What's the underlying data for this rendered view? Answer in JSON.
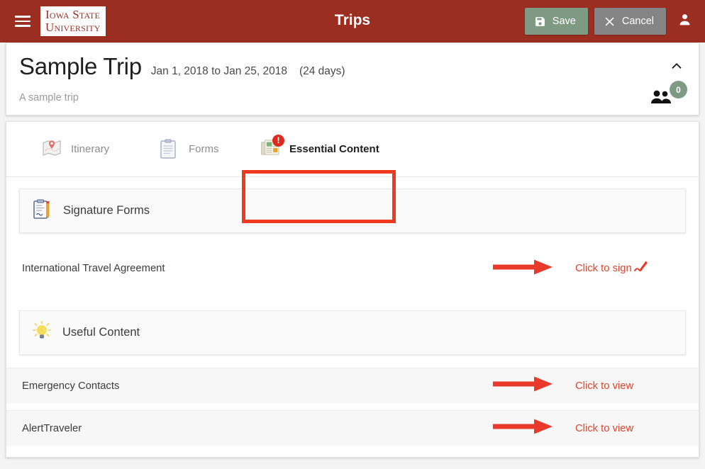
{
  "appbar": {
    "menu_icon": "hamburger-menu-icon",
    "logo_line1": "Iowa State",
    "logo_line2": "University",
    "title": "Trips",
    "save_label": "Save",
    "cancel_label": "Cancel",
    "save_icon": "floppy-disk-save-icon",
    "cancel_icon": "close-x-icon",
    "account_icon": "person-account-icon",
    "background_color": "#9B2E21",
    "save_color": "#7E9A83",
    "cancel_color": "#858585"
  },
  "trip_header": {
    "name": "Sample Trip",
    "dates": "Jan 1, 2018 to Jan 25, 2018",
    "duration": "(24 days)",
    "description": "A sample trip",
    "collapse_icon": "chevron-up-icon",
    "participants_icon": "people-group-icon",
    "participants_count": "0",
    "badge_color": "#7E9A83"
  },
  "tabs": [
    {
      "label": "Itinerary",
      "icon": "map-pin-icon",
      "active": false,
      "alert": false
    },
    {
      "label": "Forms",
      "icon": "clipboard-icon",
      "active": false,
      "alert": false
    },
    {
      "label": "Essential Content",
      "icon": "newspaper-icon",
      "active": true,
      "alert": true,
      "alert_symbol": "!"
    }
  ],
  "tab_active_underline_color": "#3B4FC4",
  "annotation": {
    "box_color": "#F03A20",
    "arrow_color": "#E8392A"
  },
  "sections": [
    {
      "title": "Signature Forms",
      "icon": "memo-clipboard-pencil-icon",
      "items": [
        {
          "name": "International Travel Agreement",
          "action_label": "Click to sign",
          "action_icon": "signature-pen-icon",
          "has_arrow_annotation": true,
          "shaded": false
        }
      ]
    },
    {
      "title": "Useful Content",
      "icon": "light-bulb-icon",
      "items": [
        {
          "name": "Emergency Contacts",
          "action_label": "Click to view",
          "action_icon": "",
          "has_arrow_annotation": true,
          "shaded": true
        },
        {
          "name": "AlertTraveler",
          "action_label": "Click to view",
          "action_icon": "",
          "has_arrow_annotation": true,
          "shaded": true
        }
      ]
    }
  ]
}
